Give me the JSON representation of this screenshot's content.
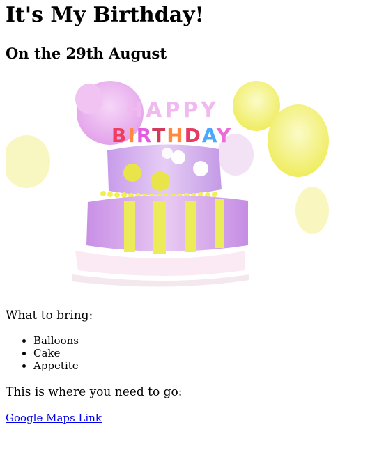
{
  "page": {
    "title": "It's My Birthday!",
    "subtitle": "On the 29th August",
    "image": {
      "banner_text_top": "HAPPY",
      "banner_text_bottom": "BIRTHDAY"
    },
    "bring_heading": "What to bring:",
    "bring_items": [
      "Balloons",
      "Cake",
      "Appetite"
    ],
    "where_heading": "This is where you need to go:",
    "map_link_label": "Google Maps Link"
  },
  "colors": {
    "link": "#0000ee",
    "cake_purple": "#b57be0",
    "cake_yellow": "#e8e44a",
    "balloon_pink": "#e9a6ef",
    "balloon_yellow": "#f3f06a"
  }
}
